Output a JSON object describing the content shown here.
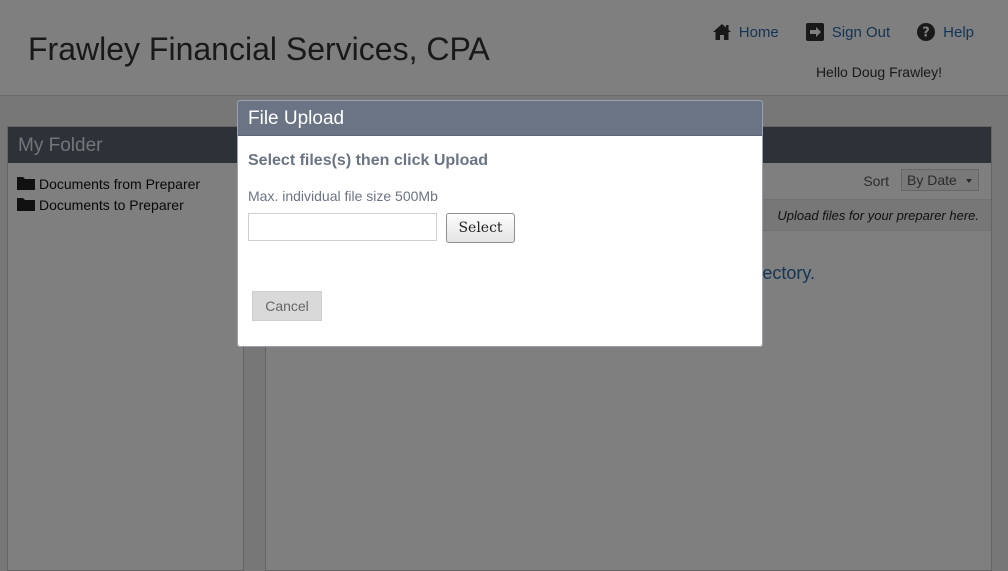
{
  "header": {
    "brand": "Frawley Financial Services, CPA",
    "nav": {
      "home_label": "Home",
      "signout_label": "Sign Out",
      "help_label": "Help"
    },
    "greeting": "Hello Doug Frawley!"
  },
  "left_panel": {
    "title": "My Folder",
    "folders": [
      {
        "label": "Documents from Preparer",
        "icon": "folder-icon"
      },
      {
        "label": "Documents to Preparer",
        "icon": "folder-icon"
      }
    ]
  },
  "right_panel": {
    "sort_label": "Sort",
    "sort_value": "By Date",
    "hint": "Upload files for your preparer here.",
    "empty_message": "ectory."
  },
  "dialog": {
    "title": "File Upload",
    "subtitle": "Select files(s) then click Upload",
    "size_note": "Max. individual file size 500Mb",
    "file_input_value": "",
    "select_label": "Select",
    "cancel_label": "Cancel"
  },
  "colors": {
    "brand_text": "#333333",
    "link": "#2a6aa8",
    "panel_header": "#5b6470",
    "dialog_header": "#6b7484",
    "overlay": "rgba(0,0,0,0.5)"
  }
}
